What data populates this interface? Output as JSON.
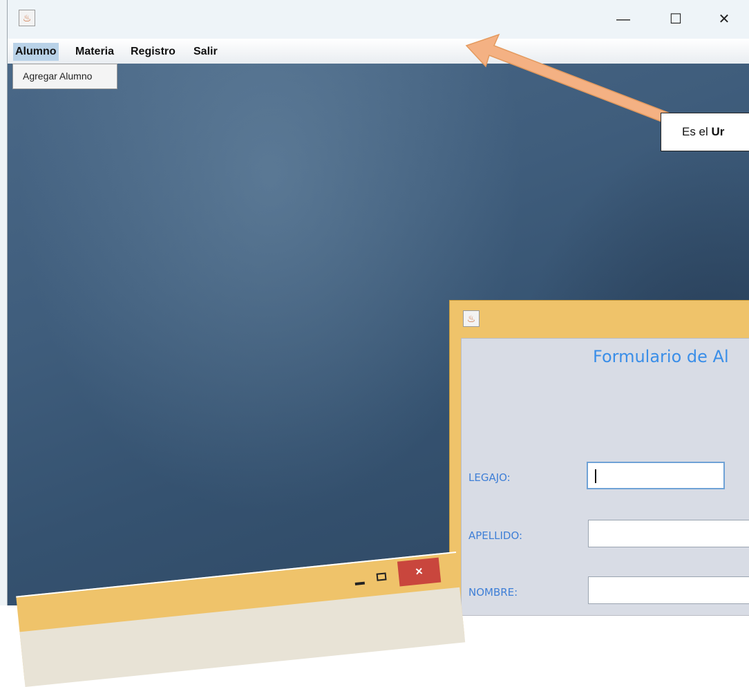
{
  "window": {
    "controls": {
      "minimize": "—",
      "maximize": "☐",
      "close": "✕"
    }
  },
  "menubar": {
    "items": [
      {
        "label": "Alumno",
        "active": true
      },
      {
        "label": "Materia"
      },
      {
        "label": "Registro"
      },
      {
        "label": "Salir"
      }
    ]
  },
  "dropdown": {
    "items": [
      {
        "label": "Agregar Alumno"
      }
    ]
  },
  "callout": {
    "text": "Es el ",
    "bold": "Ur"
  },
  "form": {
    "title": "Formulario de Al",
    "fields": [
      {
        "label": "LEGAJO:",
        "value": ""
      },
      {
        "label": "APELLIDO:",
        "value": ""
      },
      {
        "label": "NOMBRE:",
        "value": ""
      }
    ]
  },
  "lower_window": {
    "close_symbol": "×"
  },
  "colors": {
    "menu_active": "#b9d2e8",
    "form_frame": "#efc36a",
    "form_title": "#3a8ee8",
    "form_label": "#3f7fd6",
    "arrow": "#f4b183",
    "close_red": "#c9463d"
  }
}
